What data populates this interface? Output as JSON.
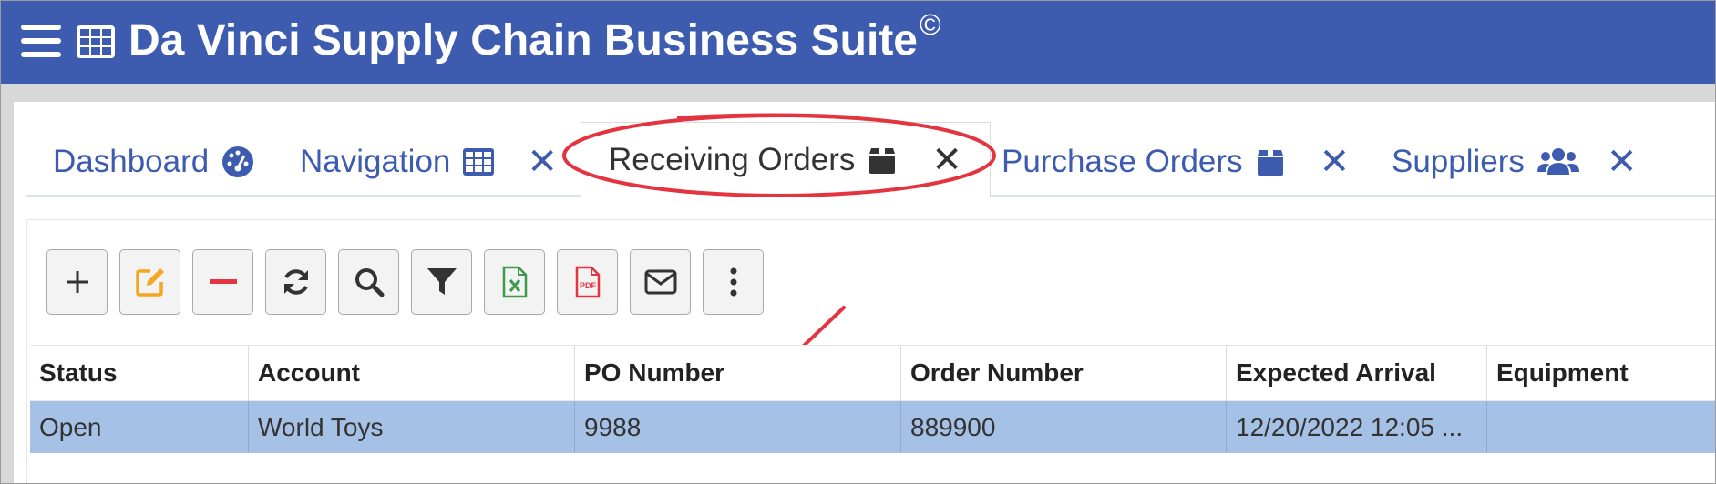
{
  "app": {
    "title": "Da Vinci Supply Chain Business Suite",
    "copyright": "©",
    "bar_color": "#3d5cb0"
  },
  "tabs": [
    {
      "label": "Dashboard",
      "icon": "dashboard-gauge-icon",
      "closable": false
    },
    {
      "label": "Navigation",
      "icon": "grid-table-icon",
      "closable": true
    },
    {
      "label": "Receiving Orders",
      "icon": "box-icon",
      "closable": true,
      "active": true
    },
    {
      "label": "Purchase Orders",
      "icon": "box-icon",
      "closable": true
    },
    {
      "label": "Suppliers",
      "icon": "users-icon",
      "closable": true
    }
  ],
  "close_glyph": "✕",
  "toolbar": [
    "add-icon",
    "edit-icon",
    "delete-icon",
    "refresh-icon",
    "search-icon",
    "filter-icon",
    "excel-export-icon",
    "pdf-export-icon",
    "email-icon",
    "more-options-icon"
  ],
  "pdf_label": "PDF",
  "grid": {
    "columns": [
      "Status",
      "Account",
      "PO Number",
      "Order Number",
      "Expected Arrival",
      "Equipment"
    ],
    "rows": [
      [
        "Open",
        "World Toys",
        "9988",
        "889900",
        "12/20/2022 12:05 ...",
        ""
      ]
    ],
    "selected_row_color": "#a6c1e6"
  },
  "annotation_color": "#e3343f"
}
